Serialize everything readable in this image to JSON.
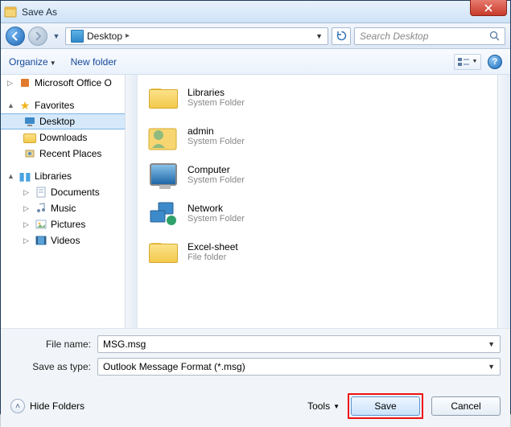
{
  "window": {
    "title": "Save As"
  },
  "nav": {
    "location": "Desktop",
    "search_placeholder": "Search Desktop"
  },
  "toolbar": {
    "organize": "Organize",
    "new_folder": "New folder"
  },
  "sidebar": {
    "office": "Microsoft Office O",
    "favorites_label": "Favorites",
    "favorites": [
      {
        "label": "Desktop",
        "selected": true
      },
      {
        "label": "Downloads"
      },
      {
        "label": "Recent Places"
      }
    ],
    "libraries_label": "Libraries",
    "libraries": [
      {
        "label": "Documents"
      },
      {
        "label": "Music"
      },
      {
        "label": "Pictures"
      },
      {
        "label": "Videos"
      }
    ]
  },
  "files": [
    {
      "name": "Libraries",
      "sub": "System Folder",
      "icon": "libraries"
    },
    {
      "name": "admin",
      "sub": "System Folder",
      "icon": "user"
    },
    {
      "name": "Computer",
      "sub": "System Folder",
      "icon": "computer"
    },
    {
      "name": "Network",
      "sub": "System Folder",
      "icon": "network"
    },
    {
      "name": "Excel-sheet",
      "sub": "File folder",
      "icon": "folder"
    }
  ],
  "footer": {
    "filename_label": "File name:",
    "filename_value": "MSG.msg",
    "type_label": "Save as type:",
    "type_value": "Outlook Message Format (*.msg)",
    "hide_folders": "Hide Folders",
    "tools": "Tools",
    "save": "Save",
    "cancel": "Cancel"
  }
}
